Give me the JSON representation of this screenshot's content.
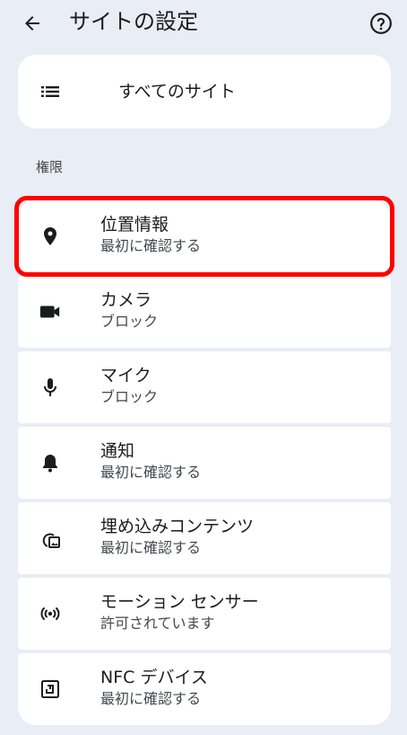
{
  "header": {
    "title": "サイトの設定",
    "back_icon": "arrow-back-icon",
    "help_icon": "help-circle-icon"
  },
  "all_sites": {
    "label": "すべてのサイト",
    "icon": "list-icon"
  },
  "section": {
    "title": "権限"
  },
  "permissions": [
    {
      "title": "位置情報",
      "subtitle": "最初に確認する",
      "icon": "location-pin-icon"
    },
    {
      "title": "カメラ",
      "subtitle": "ブロック",
      "icon": "camera-icon"
    },
    {
      "title": "マイク",
      "subtitle": "ブロック",
      "icon": "microphone-icon"
    },
    {
      "title": "通知",
      "subtitle": "最初に確認する",
      "icon": "bell-icon"
    },
    {
      "title": "埋め込みコンテンツ",
      "subtitle": "最初に確認する",
      "icon": "embedded-content-icon"
    },
    {
      "title": "モーション センサー",
      "subtitle": "許可されています",
      "icon": "motion-sensor-icon"
    },
    {
      "title": "NFC デバイス",
      "subtitle": "最初に確認する",
      "icon": "nfc-icon"
    }
  ],
  "colors": {
    "background": "#e9edf6",
    "card": "#ffffff",
    "highlight": "#ff0000"
  }
}
